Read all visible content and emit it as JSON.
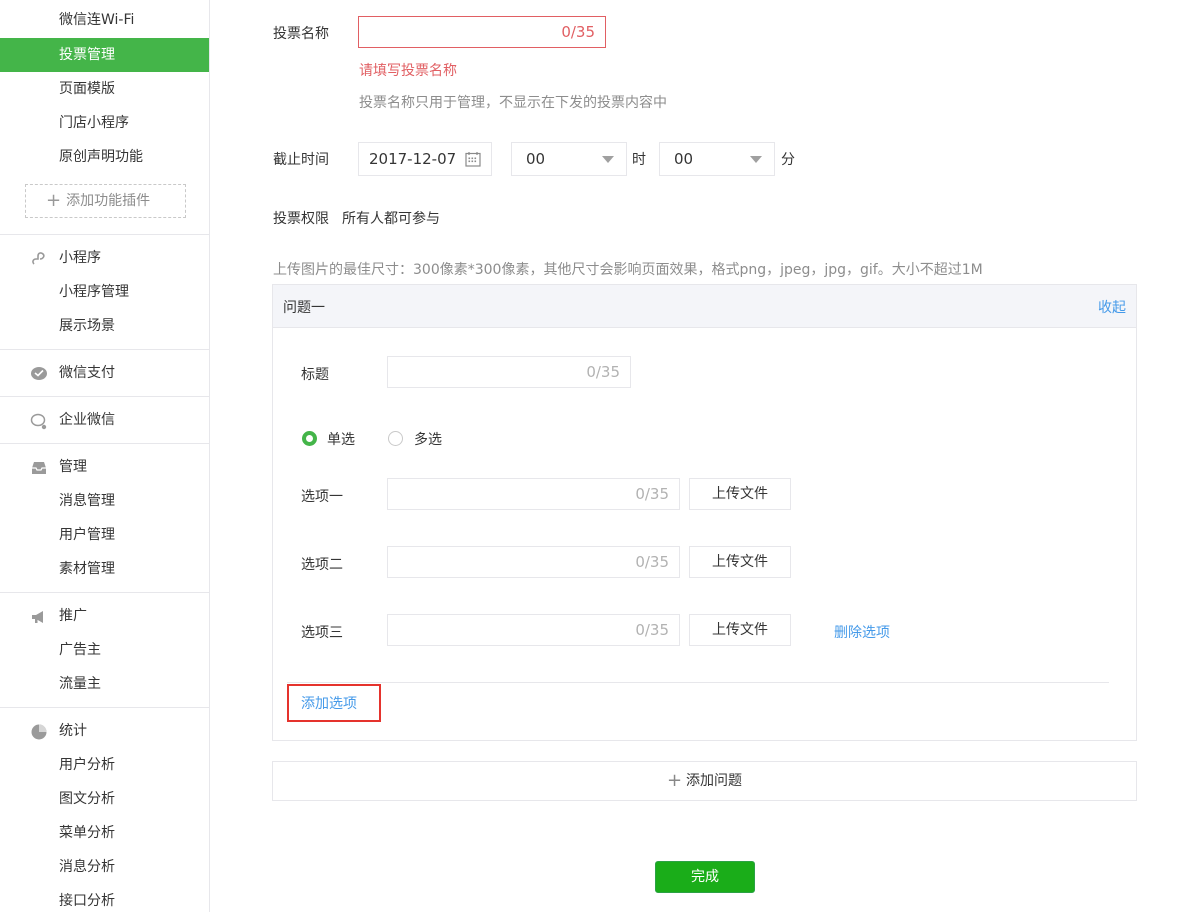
{
  "sidebar": {
    "top_items": [
      "微信连Wi-Fi",
      "投票管理",
      "页面模版",
      "门店小程序",
      "原创声明功能"
    ],
    "add_plugin": "添加功能插件",
    "miniprogram": {
      "title": "小程序",
      "items": [
        "小程序管理",
        "展示场景"
      ]
    },
    "pay": {
      "title": "微信支付"
    },
    "enterprise": {
      "title": "企业微信"
    },
    "manage": {
      "title": "管理",
      "items": [
        "消息管理",
        "用户管理",
        "素材管理"
      ]
    },
    "promote": {
      "title": "推广",
      "items": [
        "广告主",
        "流量主"
      ]
    },
    "stats": {
      "title": "统计",
      "items": [
        "用户分析",
        "图文分析",
        "菜单分析",
        "消息分析",
        "接口分析"
      ]
    }
  },
  "form": {
    "name_label": "投票名称",
    "name_counter": "0/35",
    "name_error": "请填写投票名称",
    "name_hint": "投票名称只用于管理，不显示在下发的投票内容中",
    "deadline_label": "截止时间",
    "date_value": "2017-12-07",
    "hour_value": "00",
    "hour_unit": "时",
    "minute_value": "00",
    "minute_unit": "分",
    "permission_label": "投票权限",
    "permission_value": "所有人都可参与",
    "upload_hint": "上传图片的最佳尺寸：300像素*300像素，其他尺寸会影响页面效果，格式png，jpeg，jpg，gif。大小不超过1M"
  },
  "question": {
    "title": "问题一",
    "collapse": "收起",
    "title_label": "标题",
    "title_counter": "0/35",
    "single": "单选",
    "multi": "多选",
    "options": [
      {
        "label": "选项一",
        "counter": "0/35",
        "upload": "上传文件"
      },
      {
        "label": "选项二",
        "counter": "0/35",
        "upload": "上传文件"
      },
      {
        "label": "选项三",
        "counter": "0/35",
        "upload": "上传文件",
        "delete": "删除选项"
      }
    ],
    "add_option": "添加选项"
  },
  "add_question": "添加问题",
  "done": "完成",
  "colors": {
    "accent": "#44b549",
    "error": "#e15f63",
    "link": "#459ae9",
    "done": "#1aad19"
  }
}
